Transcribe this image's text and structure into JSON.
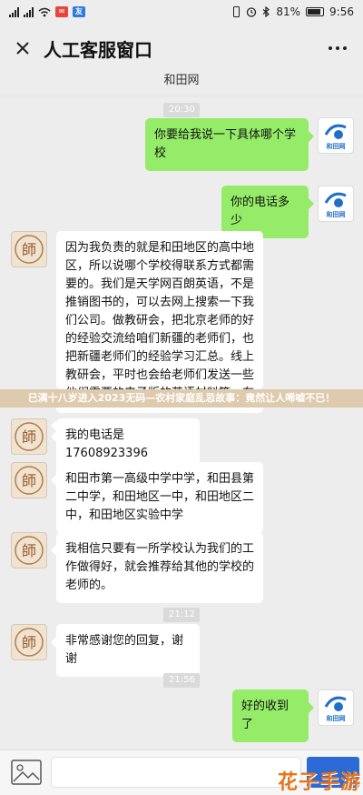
{
  "status_bar": {
    "app_badge_1": "✉",
    "app_badge_2": "友",
    "battery": "81%",
    "time": "9:56"
  },
  "header": {
    "title": "人工客服窗口"
  },
  "sub_header": {
    "title": "和田网"
  },
  "avatar_labels": {
    "bot": "師",
    "user": "和田网"
  },
  "timestamps": [
    "20:30",
    "21:12",
    "21:56"
  ],
  "messages": [
    {
      "side": "right",
      "text": "你要给我说一下具体哪个学校"
    },
    {
      "side": "right",
      "text": "你的电话多少"
    },
    {
      "side": "left",
      "text": "因为我负责的就是和田地区的高中地区，所以说哪个学校得联系方式都需要的。我们是天学网百朗英语，不是推销图书的，可以去网上搜索一下我们公司。做教研会，把北京老师的好的经验交流给咱们新疆的老师们，也把新疆老师们的经验学习汇总。线上教研会，平时也会给老师们发送一些他们需要的电子版的英语材料等，有问题也可以想我们说。我们在做教育推广遇到了很多麻烦，也联系不到学校，很想要讲是"
    },
    {
      "side": "left",
      "text": "我的电话是17608923396"
    },
    {
      "side": "left",
      "text": "和田市第一高级中学中学，和田县第二中学，和田地区一中，和田地区二中，和田地区实验中学"
    },
    {
      "side": "left",
      "text": "我相信只要有一所学校认为我们的工作做得好，就会推荐给其他的学校的老师的。"
    },
    {
      "side": "left",
      "text": "非常感谢您的回复，谢谢"
    },
    {
      "side": "right",
      "text": "好的收到了"
    }
  ],
  "overlay_banner": "已满十八岁进入2023无码—农村家庭乱忌故事：竟然让人唏嘘不已！",
  "watermark": "花子手游",
  "icons": [
    "close-icon",
    "more-icon",
    "image-icon",
    "signal-icon",
    "wifi-icon",
    "battery-icon",
    "alarm-icon",
    "bluetooth-icon",
    "vibrate-icon"
  ],
  "colors": {
    "background": "#ededed",
    "bubble_right": "#95ec69",
    "bubble_left": "#ffffff",
    "send_button": "#2c6bd6",
    "watermark": "#e8741a"
  }
}
